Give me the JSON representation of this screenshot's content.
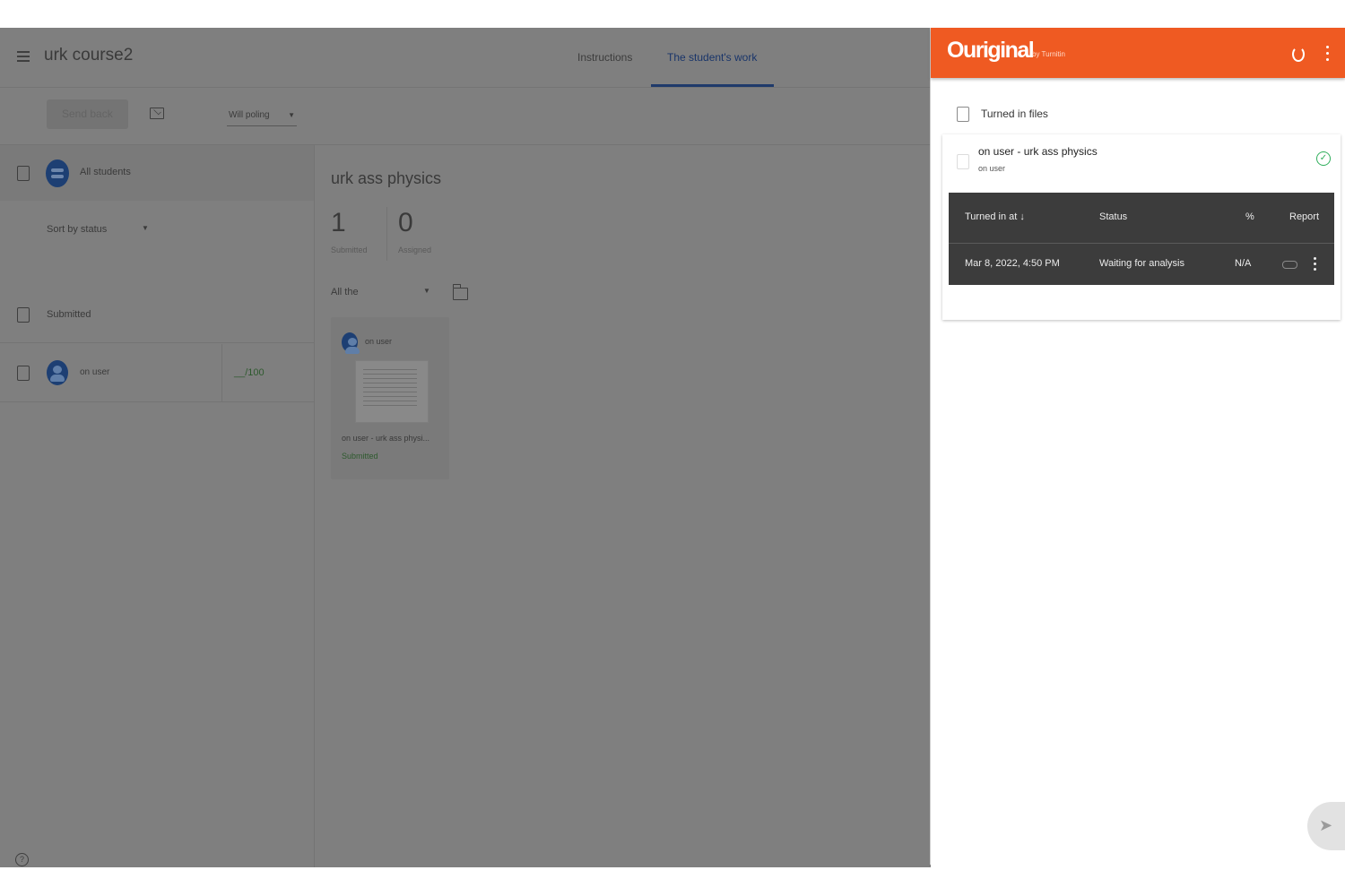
{
  "app": {
    "course_title": "urk course2",
    "tabs": [
      {
        "label": "Instructions"
      },
      {
        "label": "The student's work"
      }
    ],
    "toolbar": {
      "send_back_label": "Send back",
      "sort_select_value": "Will poling"
    },
    "sidebar": {
      "all_students_label": "All students",
      "sort_label": "Sort by status",
      "group_label": "Submitted",
      "student_name": "on user",
      "student_grade": "__/100"
    },
    "main": {
      "assignment_title": "urk ass physics",
      "submitted_count": "1",
      "submitted_label": "Submitted",
      "assigned_count": "0",
      "assigned_label": "Assigned",
      "filter_value": "All the",
      "card_student": "on user",
      "card_file_name": "on user - urk ass physi...",
      "card_status": "Submitted"
    }
  },
  "panel": {
    "brand": "Ouriginal",
    "brand_sub": "by Turnitin",
    "accent_color": "#ef5a22",
    "section_label": "Turned in files",
    "file_title": "on user - urk ass physics",
    "file_owner": "on user",
    "table": {
      "headers": [
        "Turned in at ↓",
        "Status",
        "%",
        "Report"
      ],
      "row": {
        "turned_in": "Mar 8, 2022, 4:50 PM",
        "status": "Waiting for analysis",
        "percent": "N/A"
      }
    }
  }
}
